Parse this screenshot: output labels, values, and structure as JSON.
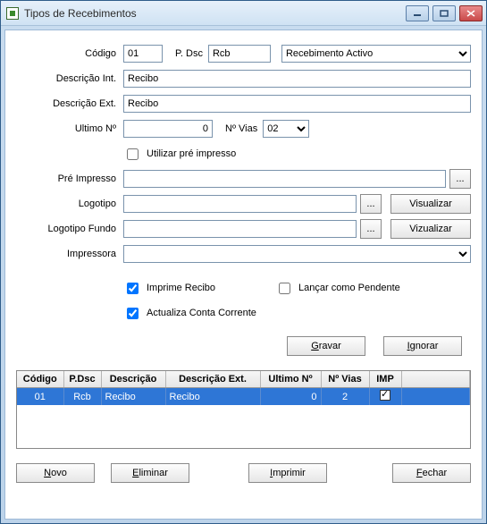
{
  "window": {
    "title": "Tipos de Recebimentos"
  },
  "labels": {
    "codigo": "Código",
    "pdsc": "P. Dsc",
    "status_option": "Recebimento Activo",
    "desc_int": "Descrição Int.",
    "desc_ext": "Descrição Ext.",
    "ultimo_no": "Ultimo Nº",
    "n_vias": "Nº Vias",
    "utilizar_pre": "Utilizar pré impresso",
    "pre_impresso": "Pré Impresso",
    "logotipo": "Logotipo",
    "logotipo_fundo": "Logotipo Fundo",
    "impressora": "Impressora",
    "imprime_recibo": "Imprime Recibo",
    "lancar_pendente": "Lançar como Pendente",
    "actualiza_cc": "Actualiza Conta Corrente",
    "ellipsis": "..."
  },
  "values": {
    "codigo": "01",
    "pdsc": "Rcb",
    "desc_int": "Recibo",
    "desc_ext": "Recibo",
    "ultimo_no": "0",
    "n_vias": "02",
    "pre_impresso": "",
    "logotipo": "",
    "logotipo_fundo": "",
    "impressora": ""
  },
  "buttons": {
    "visualizar1": "Visualizar",
    "visualizar2": "Vizualizar",
    "gravar": "Gravar",
    "ignorar": "Ignorar",
    "novo": "Novo",
    "eliminar": "Eliminar",
    "imprimir": "Imprimir",
    "fechar": "Fechar"
  },
  "grid": {
    "headers": {
      "codigo": "Código",
      "pdsc": "P.Dsc",
      "descricao": "Descrição",
      "descricao_ext": "Descrição Ext.",
      "ultimo_no": "Ultimo Nº",
      "n_vias": "Nº Vias",
      "imp": "IMP"
    },
    "rows": [
      {
        "codigo": "01",
        "pdsc": "Rcb",
        "descricao": "Recibo",
        "descricao_ext": "Recibo",
        "ultimo_no": "0",
        "n_vias": "2",
        "imp_checked": true
      }
    ]
  }
}
